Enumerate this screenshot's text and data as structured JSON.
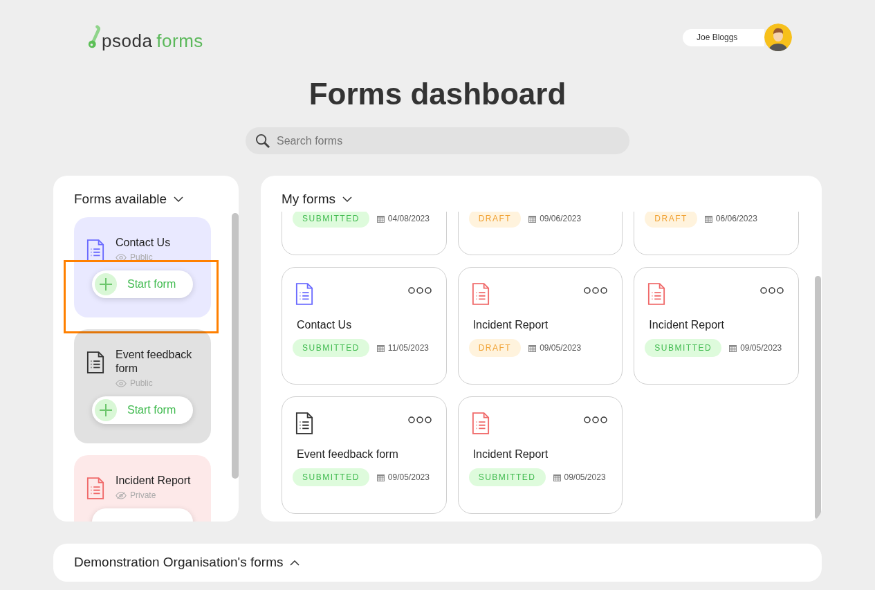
{
  "logo": {
    "brand": "psoda",
    "product": "forms"
  },
  "user": {
    "name": "Joe Bloggs"
  },
  "title": "Forms dashboard",
  "search": {
    "placeholder": "Search forms"
  },
  "forms_available": {
    "heading": "Forms available",
    "items": [
      {
        "name": "Contact Us",
        "visibility": "Public",
        "private": false,
        "color": "#6b6bff",
        "button": "Start form",
        "highlighted": true
      },
      {
        "name": "Event feedback form",
        "visibility": "Public",
        "private": false,
        "color": "#333333",
        "button": "Start form",
        "highlighted": false
      },
      {
        "name": "Incident Report",
        "visibility": "Private",
        "private": true,
        "color": "#f06a6a",
        "highlighted": false
      }
    ]
  },
  "my_forms": {
    "heading": "My forms",
    "items": [
      {
        "status": "SUBMITTED",
        "kind": "submitted",
        "date": "04/08/2023"
      },
      {
        "status": "DRAFT",
        "kind": "draft",
        "date": "09/06/2023"
      },
      {
        "status": "DRAFT",
        "kind": "draft",
        "date": "06/06/2023"
      },
      {
        "name": "Contact Us",
        "color": "#6b6bff",
        "status": "SUBMITTED",
        "kind": "submitted",
        "date": "11/05/2023"
      },
      {
        "name": "Incident Report",
        "color": "#f06a6a",
        "status": "DRAFT",
        "kind": "draft",
        "date": "09/05/2023"
      },
      {
        "name": "Incident Report",
        "color": "#f06a6a",
        "status": "SUBMITTED",
        "kind": "submitted",
        "date": "09/05/2023"
      },
      {
        "name": "Event feedback form",
        "color": "#333333",
        "status": "SUBMITTED",
        "kind": "submitted",
        "date": "09/05/2023"
      },
      {
        "name": "Incident Report",
        "color": "#f06a6a",
        "status": "SUBMITTED",
        "kind": "submitted",
        "date": "09/05/2023"
      }
    ]
  },
  "organisation": {
    "heading": "Demonstration Organisation's forms",
    "expanded": true
  }
}
